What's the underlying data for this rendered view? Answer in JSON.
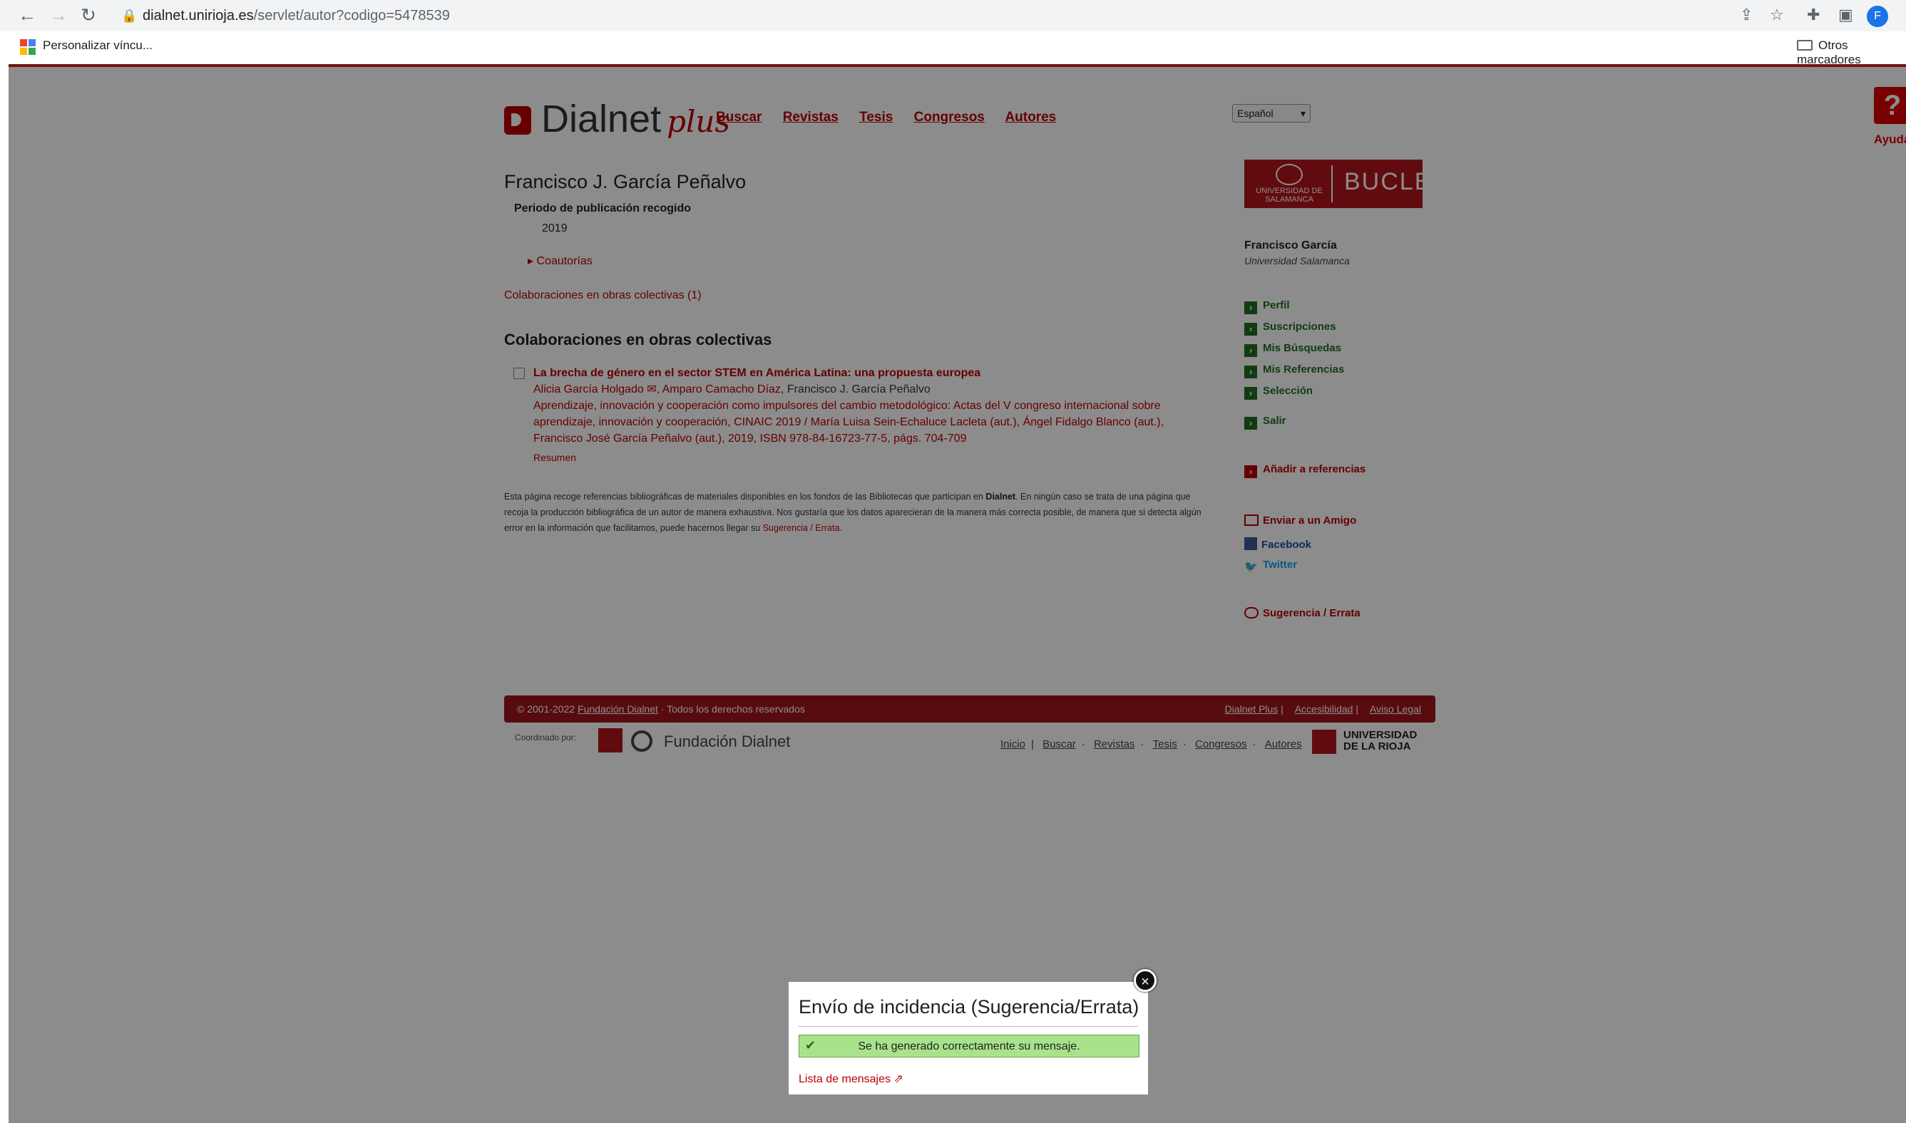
{
  "browser": {
    "url_host": "dialnet.unirioja.es",
    "url_path": "/servlet/autor?codigo=5478539",
    "bookmark_label": "Personalizar víncu...",
    "other_bookmarks": "Otros marcadores",
    "avatar_letter": "F"
  },
  "header": {
    "logo_text": "Dialnet",
    "logo_plus": "plus",
    "nav": [
      "Buscar",
      "Revistas",
      "Tesis",
      "Congresos",
      "Autores"
    ],
    "language": "Español",
    "help_icon": "?",
    "help_label": "Ayuda"
  },
  "author": {
    "name": "Francisco J. García Peñalvo",
    "period_label": "Periodo de publicación recogido",
    "period_value": "2019",
    "coauthors_link": "Coautorías",
    "collab_link": "Colaboraciones en obras colectivas (1)",
    "section_title": "Colaboraciones en obras colectivas"
  },
  "entry": {
    "title": "La brecha de género en el sector STEM en América Latina: una propuesta europea",
    "authors_linked": "Alicia García Holgado",
    "authors_linked2": ", Amparo Camacho Díaz,",
    "authors_plain": "Francisco J. García Peñalvo",
    "source": "Aprendizaje, innovación y cooperación como impulsores del cambio metodológico: Actas del V congreso internacional sobre aprendizaje, innovación y cooperación, CINAIC 2019 / María Luisa Sein-Echaluce Lacleta (aut.), Ángel Fidalgo Blanco (aut.), Francisco José García Peñalvo (aut.), 2019, ISBN 978-84-16723-77-5, págs. 704-709",
    "summary_link": "Resumen"
  },
  "disclaimer": {
    "text1": "Esta página recoge referencias bibliográficas de materiales disponibles en los fondos de las Bibliotecas que participan en ",
    "brand": "Dialnet",
    "text2": ". En ningún caso se trata de una página que recoja la producción bibliográfica de un autor de manera exhaustiva. Nos gustaría que los datos aparecieran de la manera más correcta posible, de manera que si detecta algún error en la información que facilitamos, puede hacernos llegar su ",
    "link": "Sugerencia / Errata"
  },
  "sidebar": {
    "bucle_left": "UNIVERSIDAD DE SALAMANCA",
    "bucle_right": "BUCLE",
    "user_name": "Francisco García",
    "user_uni": "Universidad Salamanca",
    "menu": [
      "Perfil",
      "Suscripciones",
      "Mis Búsquedas",
      "Mis Referencias",
      "Selección",
      "Salir"
    ],
    "add_ref": "Añadir a referencias",
    "share_friend": "Enviar a un Amigo",
    "facebook": "Facebook",
    "twitter": "Twitter",
    "suggestion": "Sugerencia / Errata"
  },
  "footer": {
    "copyright_pre": "© 2001-2022",
    "copyright_link": "Fundación Dialnet",
    "copyright_post": "· Todos los derechos reservados",
    "links": [
      "Dialnet Plus",
      "Accesibilidad",
      "Aviso Legal"
    ],
    "coord_label": "Coordinado por:",
    "fund_name": "Fundación Dialnet",
    "nav": [
      "Inicio",
      "Buscar",
      "Revistas",
      "Tesis",
      "Congresos",
      "Autores"
    ],
    "ur_line1": "UNIVERSIDAD",
    "ur_line2": "DE LA RIOJA"
  },
  "modal": {
    "title": "Envío de incidencia (Sugerencia/Errata)",
    "message": "Se ha generado correctamente su mensaje.",
    "list_link": "Lista de mensajes",
    "close_icon": "×"
  },
  "colors": {
    "brand_red": "#b00",
    "success_green": "#a8e38c",
    "menu_green": "#1f6e1f"
  }
}
